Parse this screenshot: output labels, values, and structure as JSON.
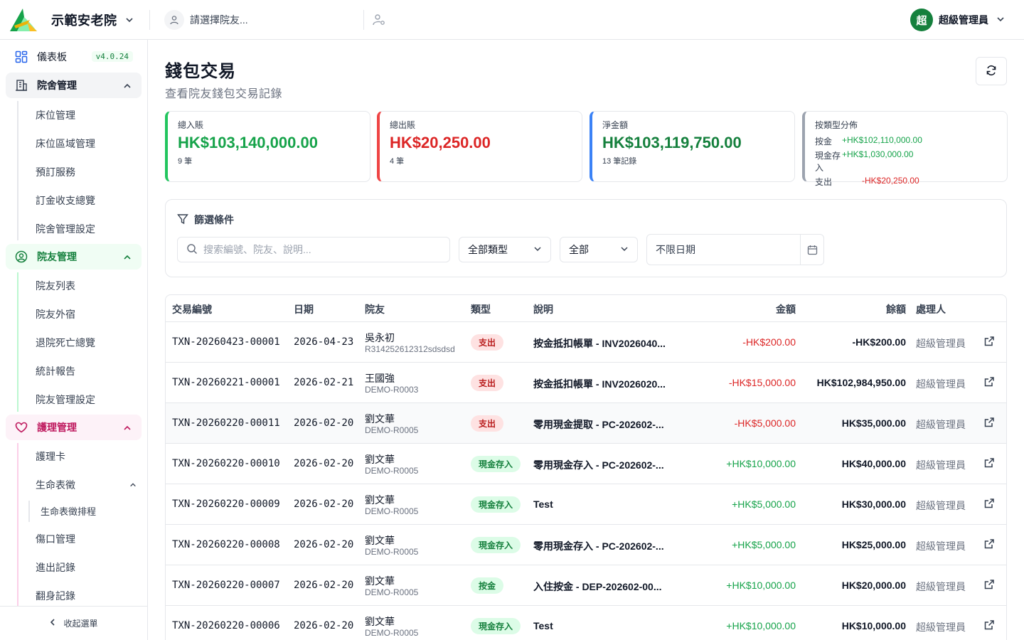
{
  "header": {
    "org_name": "示範安老院",
    "resident_placeholder": "請選擇院友...",
    "user_initial": "超",
    "user_name": "超級管理員",
    "brand_color": "#15803d"
  },
  "sidebar": {
    "dashboard": {
      "label": "儀表板",
      "version": "v4.0.24",
      "icon": "dashboard-icon"
    },
    "groups": [
      {
        "label": "院舍管理",
        "icon": "building-icon",
        "items": [
          "床位管理",
          "床位區域管理",
          "預訂服務",
          "訂金收支總覽",
          "院舍管理設定"
        ]
      },
      {
        "label": "院友管理",
        "icon": "user-circle-icon",
        "items": [
          "院友列表",
          "院友外宿",
          "退院死亡總覽",
          "統計報告",
          "院友管理設定"
        ]
      },
      {
        "label": "護理管理",
        "icon": "heart-icon",
        "items": [
          "護理卡",
          "生命表徵",
          "生命表徵排程",
          "傷口管理",
          "進出記錄",
          "翻身記錄"
        ]
      }
    ],
    "collapse_label": "收起選單"
  },
  "page": {
    "title": "錢包交易",
    "subtitle": "查看院友錢包交易記錄"
  },
  "stats": {
    "income": {
      "label": "總入賬",
      "value": "HK$103,140,000.00",
      "sub": "9 筆",
      "color": "#16a34a"
    },
    "expense": {
      "label": "總出賬",
      "value": "HK$20,250.00",
      "sub": "4 筆",
      "color": "#dc2626"
    },
    "net": {
      "label": "淨金額",
      "value": "HK$103,119,750.00",
      "sub": "13 筆記錄",
      "color": "#15803d"
    },
    "breakdown": {
      "label": "按類型分佈",
      "rows": [
        {
          "type": "按金",
          "value": "+HK$102,110,000.00"
        },
        {
          "type": "現金存入",
          "value": "+HK$1,030,000.00"
        },
        {
          "type": "支出",
          "value": "-HK$20,250.00"
        }
      ]
    }
  },
  "filters": {
    "title": "篩選條件",
    "search_placeholder": "搜索編號、院友、說明...",
    "type_select": "全部類型",
    "direction_select": "全部",
    "date": "不限日期"
  },
  "table": {
    "headers": [
      "交易編號",
      "日期",
      "院友",
      "類型",
      "說明",
      "金額",
      "餘額",
      "處理人"
    ],
    "rows": [
      {
        "id": "TXN-20260423-00001",
        "date": "2026-04-23",
        "name": "吳永初",
        "code": "R314252612312sdsdsd",
        "type": "支出",
        "kind": "out",
        "desc": "按金抵扣帳單 - INV2026040...",
        "amount": "-HK$200.00",
        "sign": "neg",
        "balance": "-HK$200.00",
        "handler": "超級管理員"
      },
      {
        "id": "TXN-20260221-00001",
        "date": "2026-02-21",
        "name": "王國強",
        "code": "DEMO-R0003",
        "type": "支出",
        "kind": "out",
        "desc": "按金抵扣帳單 - INV2026020...",
        "amount": "-HK$15,000.00",
        "sign": "neg",
        "balance": "HK$102,984,950.00",
        "handler": "超級管理員"
      },
      {
        "id": "TXN-20260220-00011",
        "date": "2026-02-20",
        "name": "劉文華",
        "code": "DEMO-R0005",
        "type": "支出",
        "kind": "out",
        "desc": "零用現金提取 - PC-202602-...",
        "amount": "-HK$5,000.00",
        "sign": "neg",
        "balance": "HK$35,000.00",
        "handler": "超級管理員"
      },
      {
        "id": "TXN-20260220-00010",
        "date": "2026-02-20",
        "name": "劉文華",
        "code": "DEMO-R0005",
        "type": "現金存入",
        "kind": "cash",
        "desc": "零用現金存入 - PC-202602-...",
        "amount": "+HK$10,000.00",
        "sign": "pos",
        "balance": "HK$40,000.00",
        "handler": "超級管理員"
      },
      {
        "id": "TXN-20260220-00009",
        "date": "2026-02-20",
        "name": "劉文華",
        "code": "DEMO-R0005",
        "type": "現金存入",
        "kind": "cash",
        "desc": "Test",
        "amount": "+HK$5,000.00",
        "sign": "pos",
        "balance": "HK$30,000.00",
        "handler": "超級管理員"
      },
      {
        "id": "TXN-20260220-00008",
        "date": "2026-02-20",
        "name": "劉文華",
        "code": "DEMO-R0005",
        "type": "現金存入",
        "kind": "cash",
        "desc": "零用現金存入 - PC-202602-...",
        "amount": "+HK$5,000.00",
        "sign": "pos",
        "balance": "HK$25,000.00",
        "handler": "超級管理員"
      },
      {
        "id": "TXN-20260220-00007",
        "date": "2026-02-20",
        "name": "劉文華",
        "code": "DEMO-R0005",
        "type": "按金",
        "kind": "dep",
        "desc": "入住按金 - DEP-202602-00...",
        "amount": "+HK$10,000.00",
        "sign": "pos",
        "balance": "HK$20,000.00",
        "handler": "超級管理員"
      },
      {
        "id": "TXN-20260220-00006",
        "date": "2026-02-20",
        "name": "劉文華",
        "code": "DEMO-R0005",
        "type": "現金存入",
        "kind": "cash",
        "desc": "Test",
        "amount": "+HK$10,000.00",
        "sign": "pos",
        "balance": "HK$10,000.00",
        "handler": "超級管理員"
      }
    ]
  }
}
